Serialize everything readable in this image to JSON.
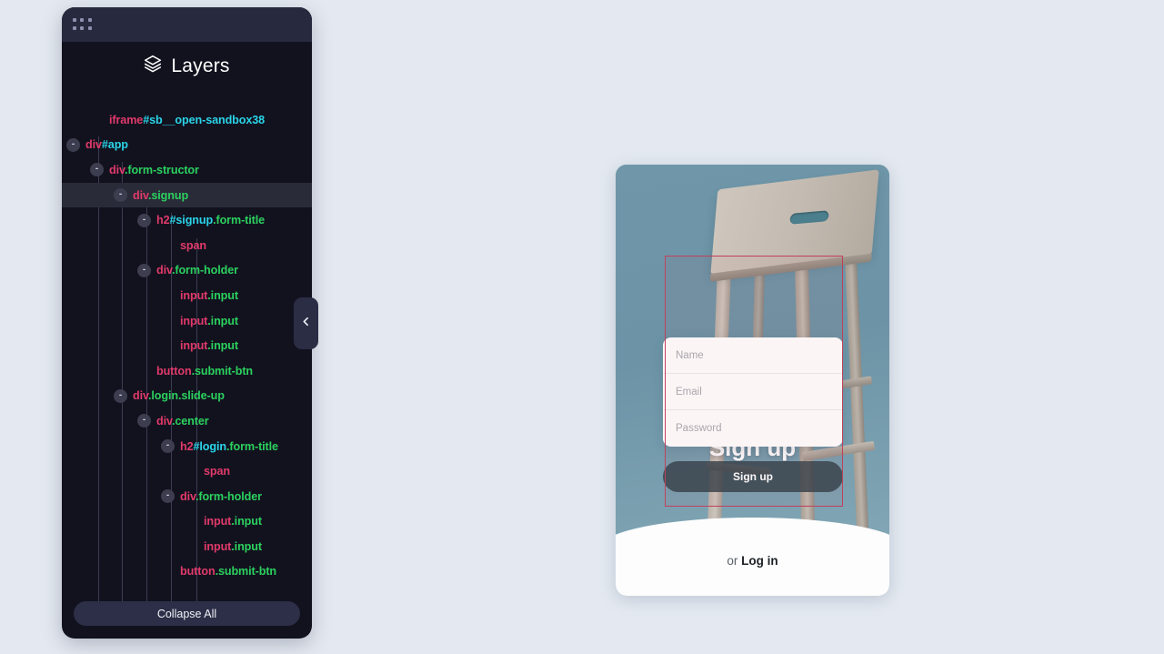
{
  "page": {
    "background_color": "#e4e9f1"
  },
  "layers_panel": {
    "title": "Layers",
    "title_icon": "layers-stack-icon",
    "drag_handle_icon": "grid-dots-icon",
    "collapse_tab_icon": "chevron-left-icon",
    "collapse_all_label": "Collapse All",
    "colors": {
      "panel_bg": "#12121f",
      "header_bg": "#272a3f",
      "tag": "#e23a6a",
      "id": "#2ad4e8",
      "class": "#2bd15e",
      "selected_row": "#2a2b38"
    },
    "tree": [
      {
        "depth": 1,
        "toggle": "",
        "tag": "iframe",
        "id": "#sb__open-sandbox38",
        "cls": "",
        "selected": false
      },
      {
        "depth": 0,
        "toggle": "-",
        "tag": "div",
        "id": "#app",
        "cls": "",
        "selected": false
      },
      {
        "depth": 1,
        "toggle": "-",
        "tag": "div",
        "id": "",
        "cls": ".form-structor",
        "selected": false
      },
      {
        "depth": 2,
        "toggle": "-",
        "tag": "div",
        "id": "",
        "cls": ".signup",
        "selected": true
      },
      {
        "depth": 3,
        "toggle": "-",
        "tag": "h2",
        "id": "#signup",
        "cls": ".form-title",
        "selected": false
      },
      {
        "depth": 4,
        "toggle": "",
        "tag": "span",
        "id": "",
        "cls": "",
        "selected": false
      },
      {
        "depth": 3,
        "toggle": "-",
        "tag": "div",
        "id": "",
        "cls": ".form-holder",
        "selected": false
      },
      {
        "depth": 4,
        "toggle": "",
        "tag": "input",
        "id": "",
        "cls": ".input",
        "selected": false
      },
      {
        "depth": 4,
        "toggle": "",
        "tag": "input",
        "id": "",
        "cls": ".input",
        "selected": false
      },
      {
        "depth": 4,
        "toggle": "",
        "tag": "input",
        "id": "",
        "cls": ".input",
        "selected": false
      },
      {
        "depth": 3,
        "toggle": "",
        "tag": "button",
        "id": "",
        "cls": ".submit-btn",
        "selected": false
      },
      {
        "depth": 2,
        "toggle": "-",
        "tag": "div",
        "id": "",
        "cls": ".login.slide-up",
        "selected": false
      },
      {
        "depth": 3,
        "toggle": "-",
        "tag": "div",
        "id": "",
        "cls": ".center",
        "selected": false
      },
      {
        "depth": 4,
        "toggle": "-",
        "tag": "h2",
        "id": "#login",
        "cls": ".form-title",
        "selected": false
      },
      {
        "depth": 5,
        "toggle": "",
        "tag": "span",
        "id": "",
        "cls": "",
        "selected": false
      },
      {
        "depth": 4,
        "toggle": "-",
        "tag": "div",
        "id": "",
        "cls": ".form-holder",
        "selected": false
      },
      {
        "depth": 5,
        "toggle": "",
        "tag": "input",
        "id": "",
        "cls": ".input",
        "selected": false
      },
      {
        "depth": 5,
        "toggle": "",
        "tag": "input",
        "id": "",
        "cls": ".input",
        "selected": false
      },
      {
        "depth": 4,
        "toggle": "",
        "tag": "button",
        "id": "",
        "cls": ".submit-btn",
        "selected": false
      }
    ],
    "guides": [
      108,
      134,
      161,
      188,
      216
    ]
  },
  "preview": {
    "signup_title": "Sign up",
    "fields": [
      {
        "name": "name",
        "placeholder": "Name",
        "value": ""
      },
      {
        "name": "email",
        "placeholder": "Email",
        "value": ""
      },
      {
        "name": "password",
        "placeholder": "Password",
        "value": ""
      }
    ],
    "submit_label": "Sign up",
    "footer_prefix": "or ",
    "footer_link": "Log in",
    "image_description": "wooden-stool-photo",
    "selection_highlight_color": "#c0405c"
  }
}
